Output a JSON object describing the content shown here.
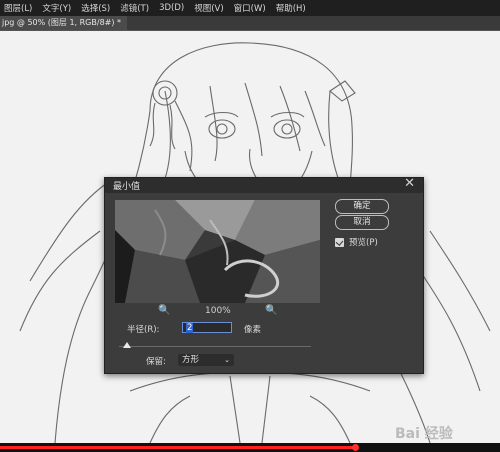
{
  "menu": [
    "图层(L)",
    "文字(Y)",
    "选择(S)",
    "滤镜(T)",
    "3D(D)",
    "视图(V)",
    "窗口(W)",
    "帮助(H)"
  ],
  "document_tab": "jpg @ 50% (图层 1, RGB/8#) *",
  "dialog": {
    "title": "最小值",
    "close": "✕",
    "ok_label": "确定",
    "cancel_label": "取消",
    "preview_label": "预览(P)",
    "preview_checked": true,
    "zoom_in_icon": "🔍",
    "zoom_level": "100%",
    "zoom_out_icon": "🔍",
    "radius_label": "半径(R):",
    "radius_value": "2",
    "radius_unit": "像素",
    "radius_slider_fraction": 0.02,
    "preserve_label": "保留:",
    "preserve_value": "方形",
    "preserve_arrow": "⌄"
  },
  "watermark": "Bai 经验",
  "video_progress_fraction": 0.71,
  "colors": {
    "menubar_bg": "#1f1f1f",
    "dialog_bg": "#3c3c3c",
    "progress": "#ff2020"
  }
}
